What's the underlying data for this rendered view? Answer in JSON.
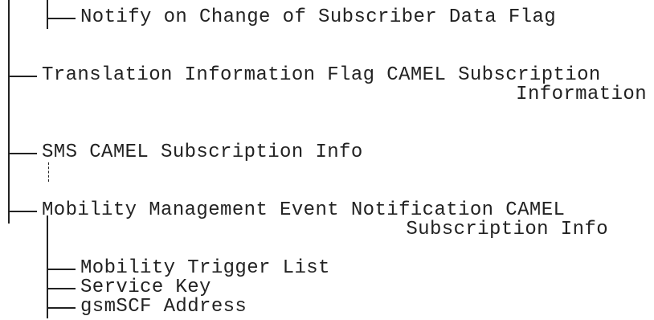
{
  "tree": {
    "items": [
      {
        "label": "Notify on Change of Subscriber Data Flag"
      },
      {
        "label_line1": "Translation Information Flag CAMEL Subscription",
        "label_line2": "Information"
      },
      {
        "label": "SMS CAMEL Subscription Info"
      },
      {
        "label_line1": "Mobility Management Event Notification CAMEL",
        "label_line2": "Subscription Info",
        "children": [
          {
            "label": "Mobility Trigger List"
          },
          {
            "label": "Service Key"
          },
          {
            "label": "gsmSCF Address"
          }
        ]
      }
    ]
  }
}
